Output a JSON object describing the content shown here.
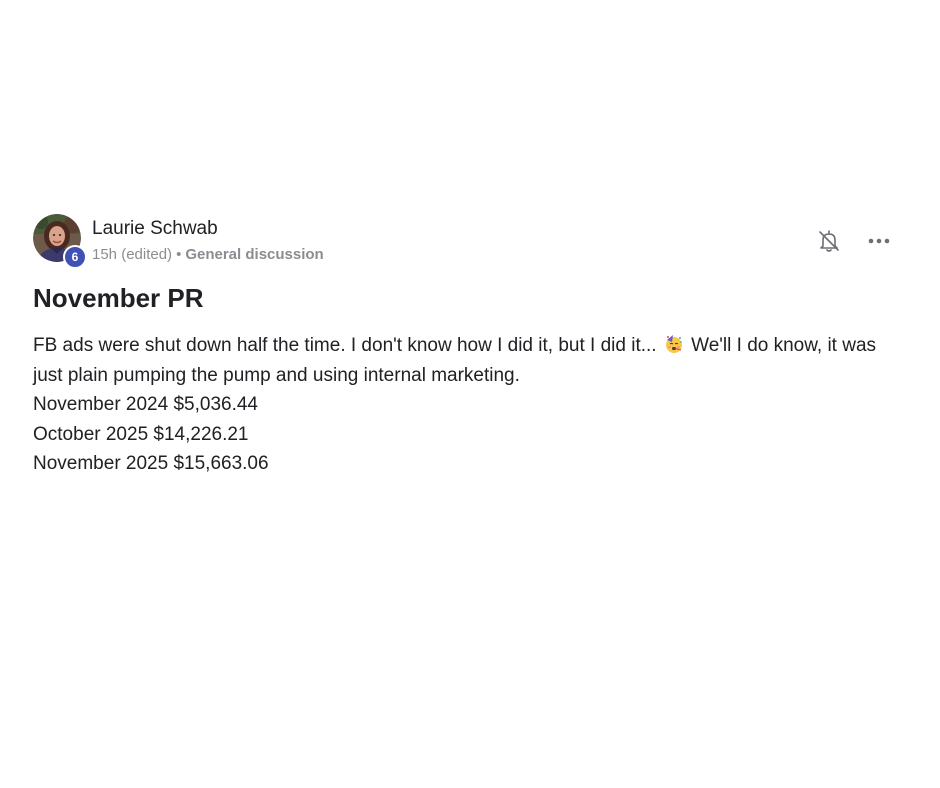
{
  "post": {
    "author": {
      "name": "Laurie Schwab",
      "level": "6"
    },
    "meta": {
      "time": "15h (edited)",
      "separator": "•",
      "category": "General discussion"
    },
    "actions": {
      "notify_icon": "bell-off-icon",
      "more_icon": "more-horizontal-icon"
    },
    "title": "November PR",
    "body": {
      "paragraph_before_emoji": "FB ads were shut down half the time. I don't know how I did it, but I did it...",
      "emoji": "partying-face",
      "paragraph_after_emoji": "We'll I do know, it was just plain pumping the pump and using internal marketing.",
      "lines": [
        "November 2024 $5,036.44",
        "October 2025 $14,226.21",
        "November 2025 $15,663.06"
      ]
    }
  },
  "colors": {
    "badge": "#3f51b5",
    "meta_text": "#8a8d91",
    "text": "#202124"
  }
}
